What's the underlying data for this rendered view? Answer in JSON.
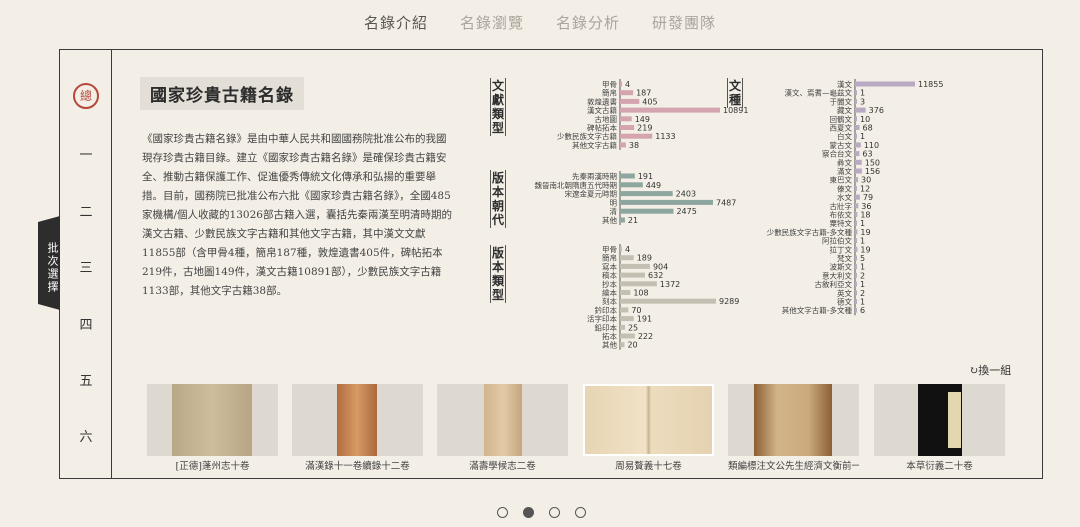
{
  "nav": [
    "名錄介紹",
    "名錄瀏覽",
    "名錄分析",
    "研發團隊"
  ],
  "chapters": [
    "總",
    "一",
    "二",
    "三",
    "四",
    "五",
    "六"
  ],
  "side_tab": "批次選擇",
  "title": "國家珍貴古籍名錄",
  "intro": "《國家珍貴古籍名錄》是由中華人民共和國國務院批准公布的我國現存珍貴古籍目錄。建立《國家珍貴古籍名錄》是確保珍貴古籍安全、推動古籍保護工作、促進優秀傳統文化傳承和弘揚的重要舉措。目前，國務院已批准公布六批《國家珍貴古籍名錄》，全國485家機構/個人收藏的13026部古籍入選，囊括先秦兩漢至明清時期的漢文古籍、少數民族文字古籍和其他文字古籍，其中漢文文獻11855部（含甲骨4種，簡帛187種，敦煌遺書405件，碑帖拓本219件，古地圖149件，漢文古籍10891部），少數民族文字古籍1133部，其他文字古籍38部。",
  "chart_labels": {
    "doc_type": "文獻類型",
    "era": "版本朝代",
    "edition": "版本類型",
    "script": "文種"
  },
  "chart_data": [
    {
      "type": "bar",
      "title": "文獻類型",
      "categories": [
        "甲骨",
        "簡帛",
        "敦煌遺書",
        "漢文古籍",
        "古地圖",
        "碑帖拓本",
        "少數民族文字古籍",
        "其他文字古籍"
      ],
      "values": [
        4,
        187,
        405,
        10891,
        149,
        219,
        1133,
        38
      ],
      "color": "#d4a5ae"
    },
    {
      "type": "bar",
      "title": "版本朝代",
      "categories": [
        "先秦兩漢時期",
        "魏晉南北朝隋唐五代時期",
        "宋遼金夏元時期",
        "明",
        "清",
        "其他"
      ],
      "values": [
        191,
        449,
        2403,
        7487,
        2475,
        21
      ],
      "color": "#8da69f"
    },
    {
      "type": "bar",
      "title": "版本類型",
      "categories": [
        "甲骨",
        "簡帛",
        "寫本",
        "稿本",
        "抄本",
        "繪本",
        "刻本",
        "鈐印本",
        "活字印本",
        "鉛印本",
        "拓本",
        "其他"
      ],
      "values": [
        4,
        189,
        904,
        632,
        1372,
        108,
        9289,
        70,
        191,
        25,
        222,
        20
      ],
      "color": "#c3c0b3"
    },
    {
      "type": "bar",
      "title": "文種",
      "categories": [
        "漢文",
        "漢文、焉耆—龜茲文",
        "于闐文",
        "藏文",
        "回鶻文",
        "西夏文",
        "白文",
        "蒙古文",
        "察合台文",
        "彝文",
        "滿文",
        "東巴文",
        "傣文",
        "水文",
        "古壯字",
        "布依文",
        "粟特文",
        "少數民族文字古籍-多文種",
        "阿拉伯文",
        "拉丁文",
        "梵文",
        "波斯文",
        "意大利文",
        "古敘利亞文",
        "英文",
        "德文",
        "其他文字古籍-多文種"
      ],
      "values": [
        11855,
        1,
        3,
        376,
        10,
        68,
        1,
        110,
        63,
        150,
        156,
        30,
        12,
        79,
        36,
        18,
        1,
        19,
        1,
        19,
        5,
        1,
        2,
        1,
        2,
        1,
        6
      ],
      "color": "#b8aac5"
    }
  ],
  "refresh_label": "換一組",
  "thumbnails": [
    "[正德]蓬州志十卷",
    "滿漢錄十一卷續錄十二卷",
    "滿壽學候志二卷",
    "周易贅義十七卷",
    "類編標注文公先生經濟文衡前一",
    "本草衍義二十卷"
  ],
  "pagination": {
    "total": 4,
    "active": 1
  }
}
